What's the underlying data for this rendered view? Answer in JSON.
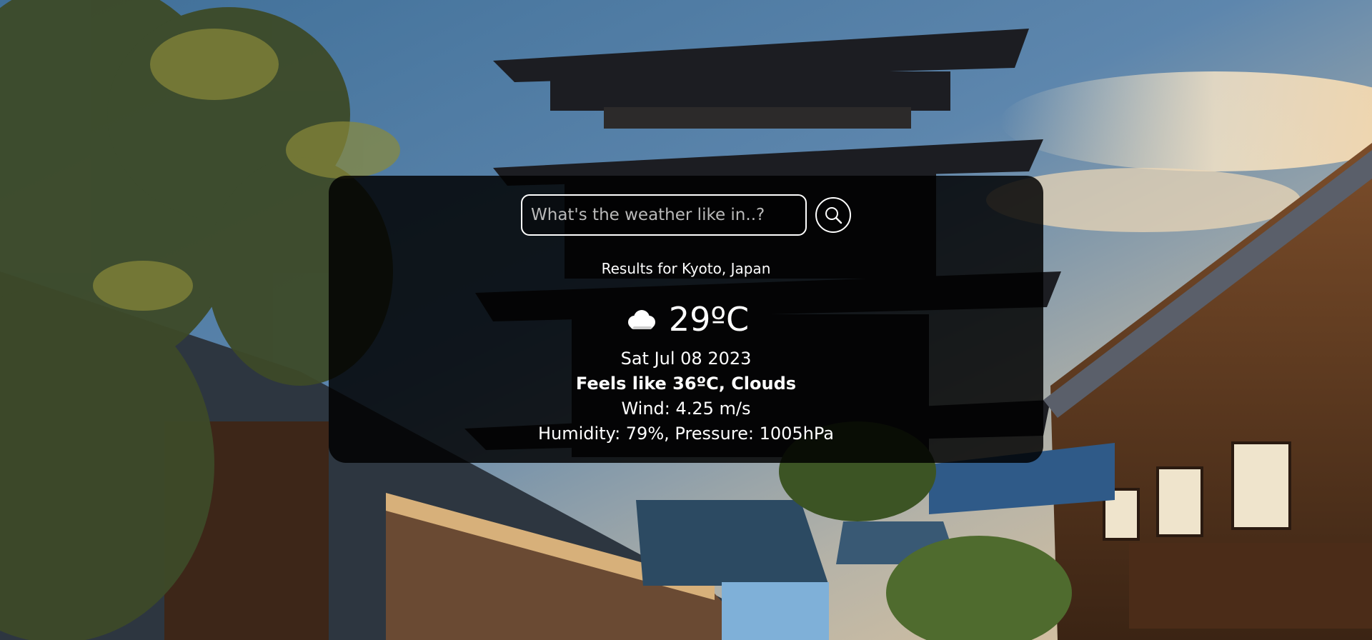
{
  "search": {
    "placeholder": "What's the weather like in..?"
  },
  "weather": {
    "results_label": "Results for Kyoto, Japan",
    "icon": "cloud-icon",
    "temperature": "29ºC",
    "date": "Sat Jul 08 2023",
    "feels_like": "Feels like 36ºC, Clouds",
    "wind": "Wind: 4.25 m/s",
    "humidity_pressure": "Humidity: 79%, Pressure: 1005hPa"
  },
  "colors": {
    "card_background": "#000000",
    "text": "#ffffff",
    "placeholder": "#b9b9b9"
  }
}
